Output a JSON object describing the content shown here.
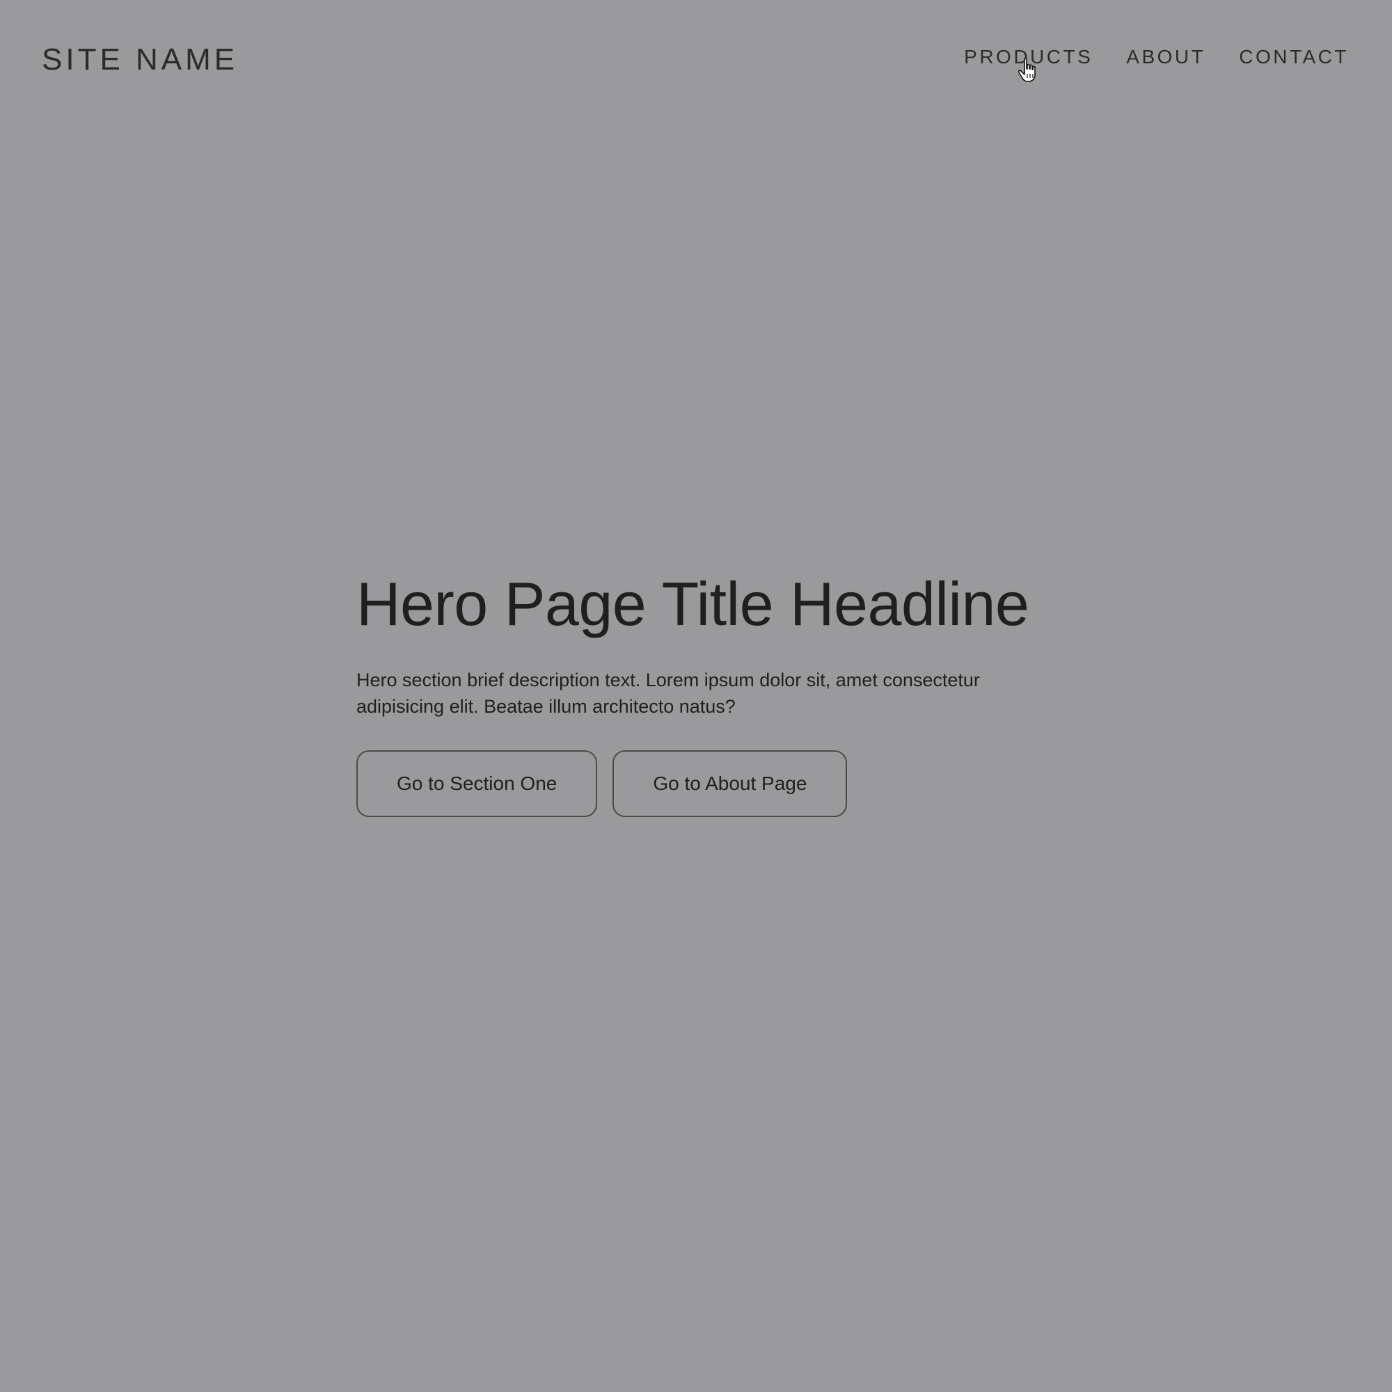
{
  "header": {
    "site_name": "SITE NAME",
    "nav": [
      {
        "label": "PRODUCTS"
      },
      {
        "label": "ABOUT"
      },
      {
        "label": "CONTACT"
      }
    ]
  },
  "hero": {
    "title": "Hero Page Title Headline",
    "description": "Hero section brief description text. Lorem ipsum dolor sit, amet consectetur adipisicing elit. Beatae illum architecto natus?",
    "primary_button": "Go to Section One",
    "secondary_button": "Go to About Page"
  },
  "colors": {
    "background": "#9a9a9c",
    "text": "#222222",
    "button_border": "#4a4a4a"
  },
  "cursor": {
    "icon": "hand-pointer-icon"
  }
}
